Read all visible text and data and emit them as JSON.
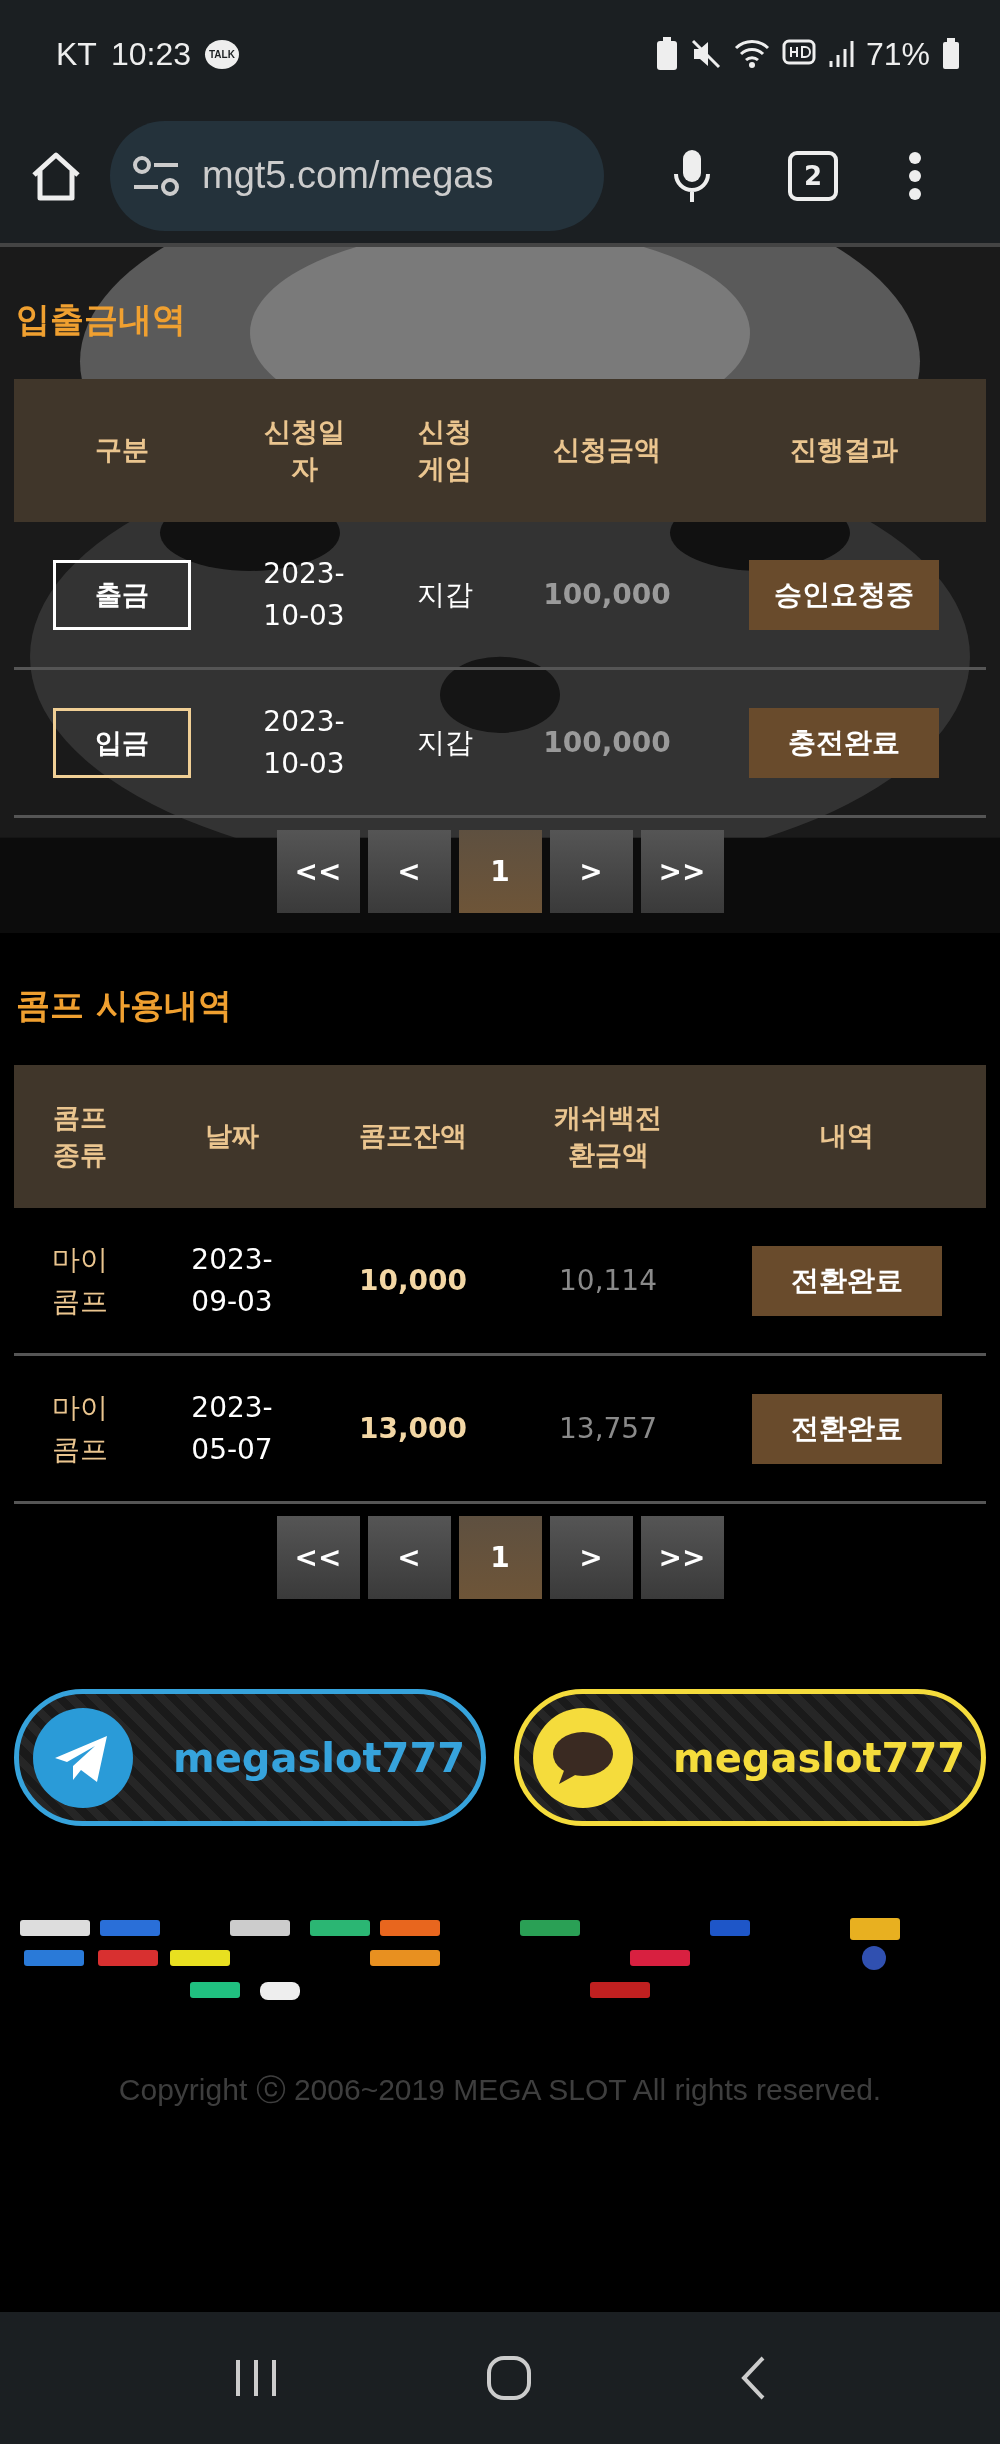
{
  "status_bar": {
    "carrier": "KT",
    "time": "10:23",
    "talk_badge": "TALK",
    "battery": "71%"
  },
  "browser": {
    "url": "mgt5.com/megas",
    "tab_count": "2"
  },
  "deposit_history": {
    "title": "입출금내역",
    "columns": [
      "구분",
      "신청일\n자",
      "신청\n게임",
      "신청금액",
      "진행결과"
    ],
    "rows": [
      {
        "type": "출금",
        "kind": "withdraw",
        "date": "2023-\n10-03",
        "game": "지갑",
        "amount": "100,000",
        "result": "승인요청중"
      },
      {
        "type": "입금",
        "kind": "deposit",
        "date": "2023-\n10-03",
        "game": "지갑",
        "amount": "100,000",
        "result": "충전완료"
      }
    ],
    "pages": [
      {
        "label": "<<",
        "selected": false
      },
      {
        "label": "<",
        "selected": false
      },
      {
        "label": "1",
        "selected": true
      },
      {
        "label": ">",
        "selected": false
      },
      {
        "label": ">>",
        "selected": false
      }
    ]
  },
  "comp_history": {
    "title": "콤프 사용내역",
    "columns": [
      "콤프\n종류",
      "날짜",
      "콤프잔액",
      "캐쉬백전\n환금액",
      "내역"
    ],
    "rows": [
      {
        "type": "마이\n콤프",
        "date": "2023-\n09-03",
        "balance": "10,000",
        "cashback": "10,114",
        "result": "전환완료"
      },
      {
        "type": "마이\n콤프",
        "date": "2023-\n05-07",
        "balance": "13,000",
        "cashback": "13,757",
        "result": "전환완료"
      }
    ],
    "pages": [
      {
        "label": "<<",
        "selected": false
      },
      {
        "label": "<",
        "selected": false
      },
      {
        "label": "1",
        "selected": true
      },
      {
        "label": ">",
        "selected": false
      },
      {
        "label": ">>",
        "selected": false
      }
    ]
  },
  "contacts": [
    {
      "kind": "telegram",
      "label": "megaslot777",
      "color": "#36a3dc"
    },
    {
      "kind": "kakao",
      "label": "megaslot777",
      "color": "#f5dc3c"
    }
  ],
  "copyright": "Copyright ⓒ 2006~2019 MEGA SLOT All rights reserved."
}
